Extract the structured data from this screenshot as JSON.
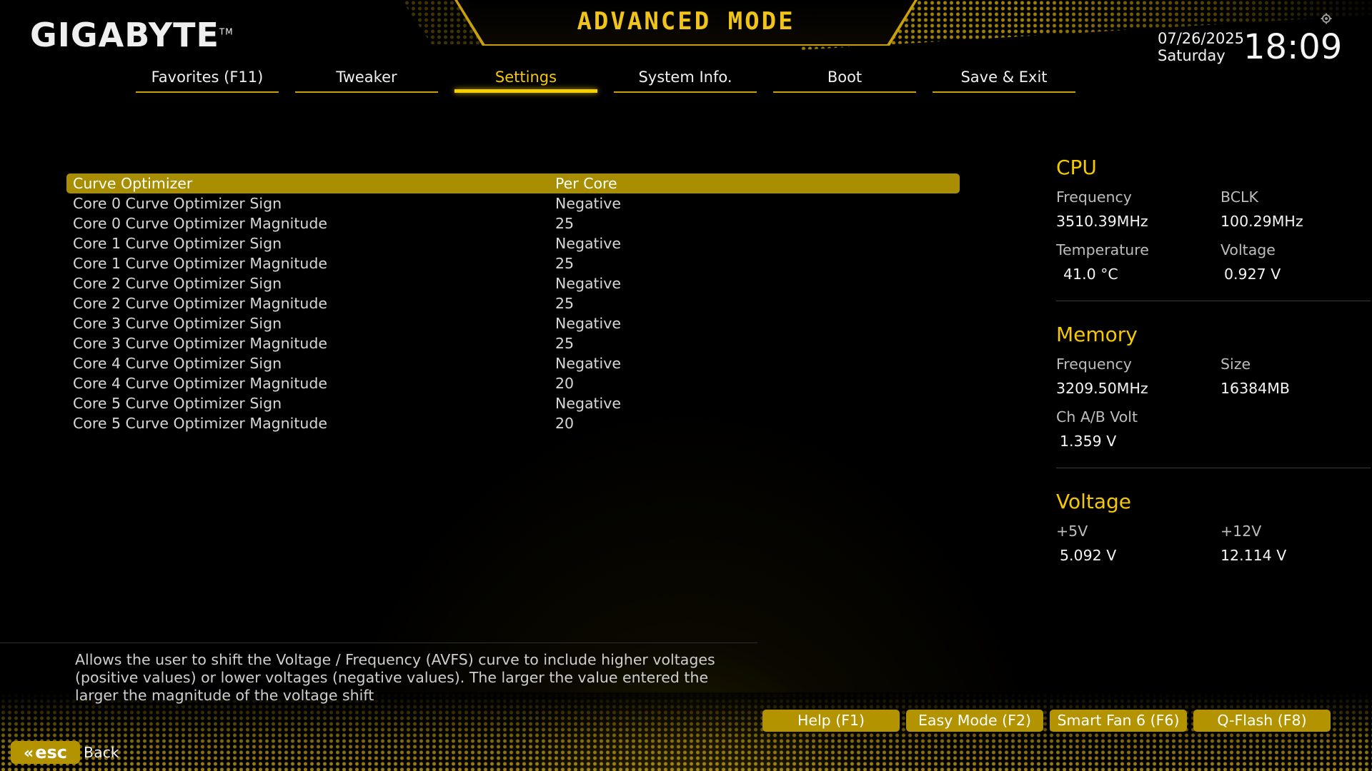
{
  "brand": {
    "logo_text": "GIGABYTE",
    "tm": "TM"
  },
  "header": {
    "mode_title": "ADVANCED MODE",
    "date": "07/26/2025",
    "weekday": "Saturday",
    "time": "18:09",
    "settings_icon": "gear-icon"
  },
  "tabs": [
    {
      "label": "Favorites (F11)",
      "active": false
    },
    {
      "label": "Tweaker",
      "active": false
    },
    {
      "label": "Settings",
      "active": true
    },
    {
      "label": "System Info.",
      "active": false
    },
    {
      "label": "Boot",
      "active": false
    },
    {
      "label": "Save & Exit",
      "active": false
    }
  ],
  "settings": [
    {
      "label": "Curve Optimizer",
      "value": "Per Core",
      "selected": true
    },
    {
      "label": "Core 0 Curve Optimizer Sign",
      "value": "Negative"
    },
    {
      "label": "Core 0 Curve Optimizer Magnitude",
      "value": "25"
    },
    {
      "label": "Core 1 Curve Optimizer Sign",
      "value": "Negative"
    },
    {
      "label": "Core 1 Curve Optimizer Magnitude",
      "value": "25"
    },
    {
      "label": "Core 2 Curve Optimizer Sign",
      "value": "Negative"
    },
    {
      "label": "Core 2 Curve Optimizer Magnitude",
      "value": "25"
    },
    {
      "label": "Core 3 Curve Optimizer Sign",
      "value": "Negative"
    },
    {
      "label": "Core 3 Curve Optimizer Magnitude",
      "value": "25"
    },
    {
      "label": "Core 4 Curve Optimizer Sign",
      "value": "Negative"
    },
    {
      "label": "Core 4 Curve Optimizer Magnitude",
      "value": "20"
    },
    {
      "label": "Core 5 Curve Optimizer Sign",
      "value": "Negative"
    },
    {
      "label": "Core 5 Curve Optimizer Magnitude",
      "value": "20"
    }
  ],
  "info": {
    "cpu": {
      "title": "CPU",
      "frequency_label": "Frequency",
      "frequency": "3510.39MHz",
      "bclk_label": "BCLK",
      "bclk": "100.29MHz",
      "temperature_label": "Temperature",
      "temperature": "41.0 °C",
      "voltage_label": "Voltage",
      "voltage": "0.927 V"
    },
    "memory": {
      "title": "Memory",
      "frequency_label": "Frequency",
      "frequency": "3209.50MHz",
      "size_label": "Size",
      "size": "16384MB",
      "chab_volt_label": "Ch A/B Volt",
      "chab_volt": "1.359 V"
    },
    "voltage": {
      "title": "Voltage",
      "v5_label": "+5V",
      "v5": "5.092 V",
      "v12_label": "+12V",
      "v12": "12.114 V"
    }
  },
  "help": {
    "text": "Allows the user to shift the Voltage / Frequency (AVFS) curve to include higher voltages (positive values) or lower voltages (negative values). The larger the value entered the larger the magnitude of the voltage shift"
  },
  "function_buttons": [
    {
      "label": "Help (F1)"
    },
    {
      "label": "Easy Mode (F2)"
    },
    {
      "label": "Smart Fan 6 (F6)"
    },
    {
      "label": "Q-Flash (F8)"
    }
  ],
  "footer": {
    "esc_label": "esc",
    "back_label": "Back",
    "esc_icon": "double-chevron-left-icon"
  },
  "colors": {
    "accent": "#f5c800",
    "highlight_bg": "#a88e00",
    "button_bg": "#b39300",
    "background": "#000000"
  }
}
